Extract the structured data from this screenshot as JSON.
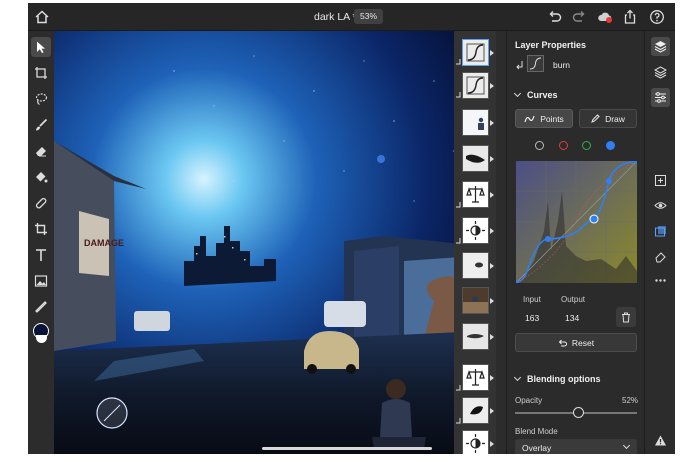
{
  "topbar": {
    "document_title": "dark LA *",
    "zoom_level": "53%",
    "icons": [
      "home-icon",
      "undo-icon",
      "redo-icon",
      "cloud-icon",
      "share-icon",
      "help-icon"
    ]
  },
  "tools": [
    "select-tool",
    "transform-tool",
    "lasso-tool",
    "brush-tool",
    "eraser-tool",
    "fill-tool",
    "heal-tool",
    "crop-tool",
    "type-tool",
    "image-tool",
    "eyedropper-tool",
    "color-swatch"
  ],
  "layers": {
    "count_shown": 13,
    "selected_index": 0
  },
  "panel": {
    "title": "Layer Properties",
    "layer_name": "burn",
    "curves": {
      "heading": "Curves",
      "points_label": "Points",
      "draw_label": "Draw",
      "channels": [
        "RGB",
        "Red",
        "Green",
        "Blue"
      ],
      "active_channel": "Blue",
      "input_label": "Input",
      "output_label": "Output",
      "input_value": "163",
      "output_value": "134",
      "reset_label": "Reset"
    },
    "blending": {
      "heading": "Blending options",
      "opacity_label": "Opacity",
      "opacity_value": "52%",
      "opacity_fraction": 0.52,
      "blend_mode_label": "Blend Mode",
      "blend_mode_value": "Overlay"
    }
  },
  "right_icons": [
    "layers-icon",
    "layer-stack-icon",
    "adjust-properties-icon",
    "add-layer-icon",
    "visibility-icon",
    "mask-icon",
    "clear-layer-icon",
    "more-icon",
    "warning-icon"
  ],
  "colors": {
    "accent": "#3d8bff",
    "panel_bg": "#2b2b2b",
    "curve_blue": "#2f7ff5"
  }
}
